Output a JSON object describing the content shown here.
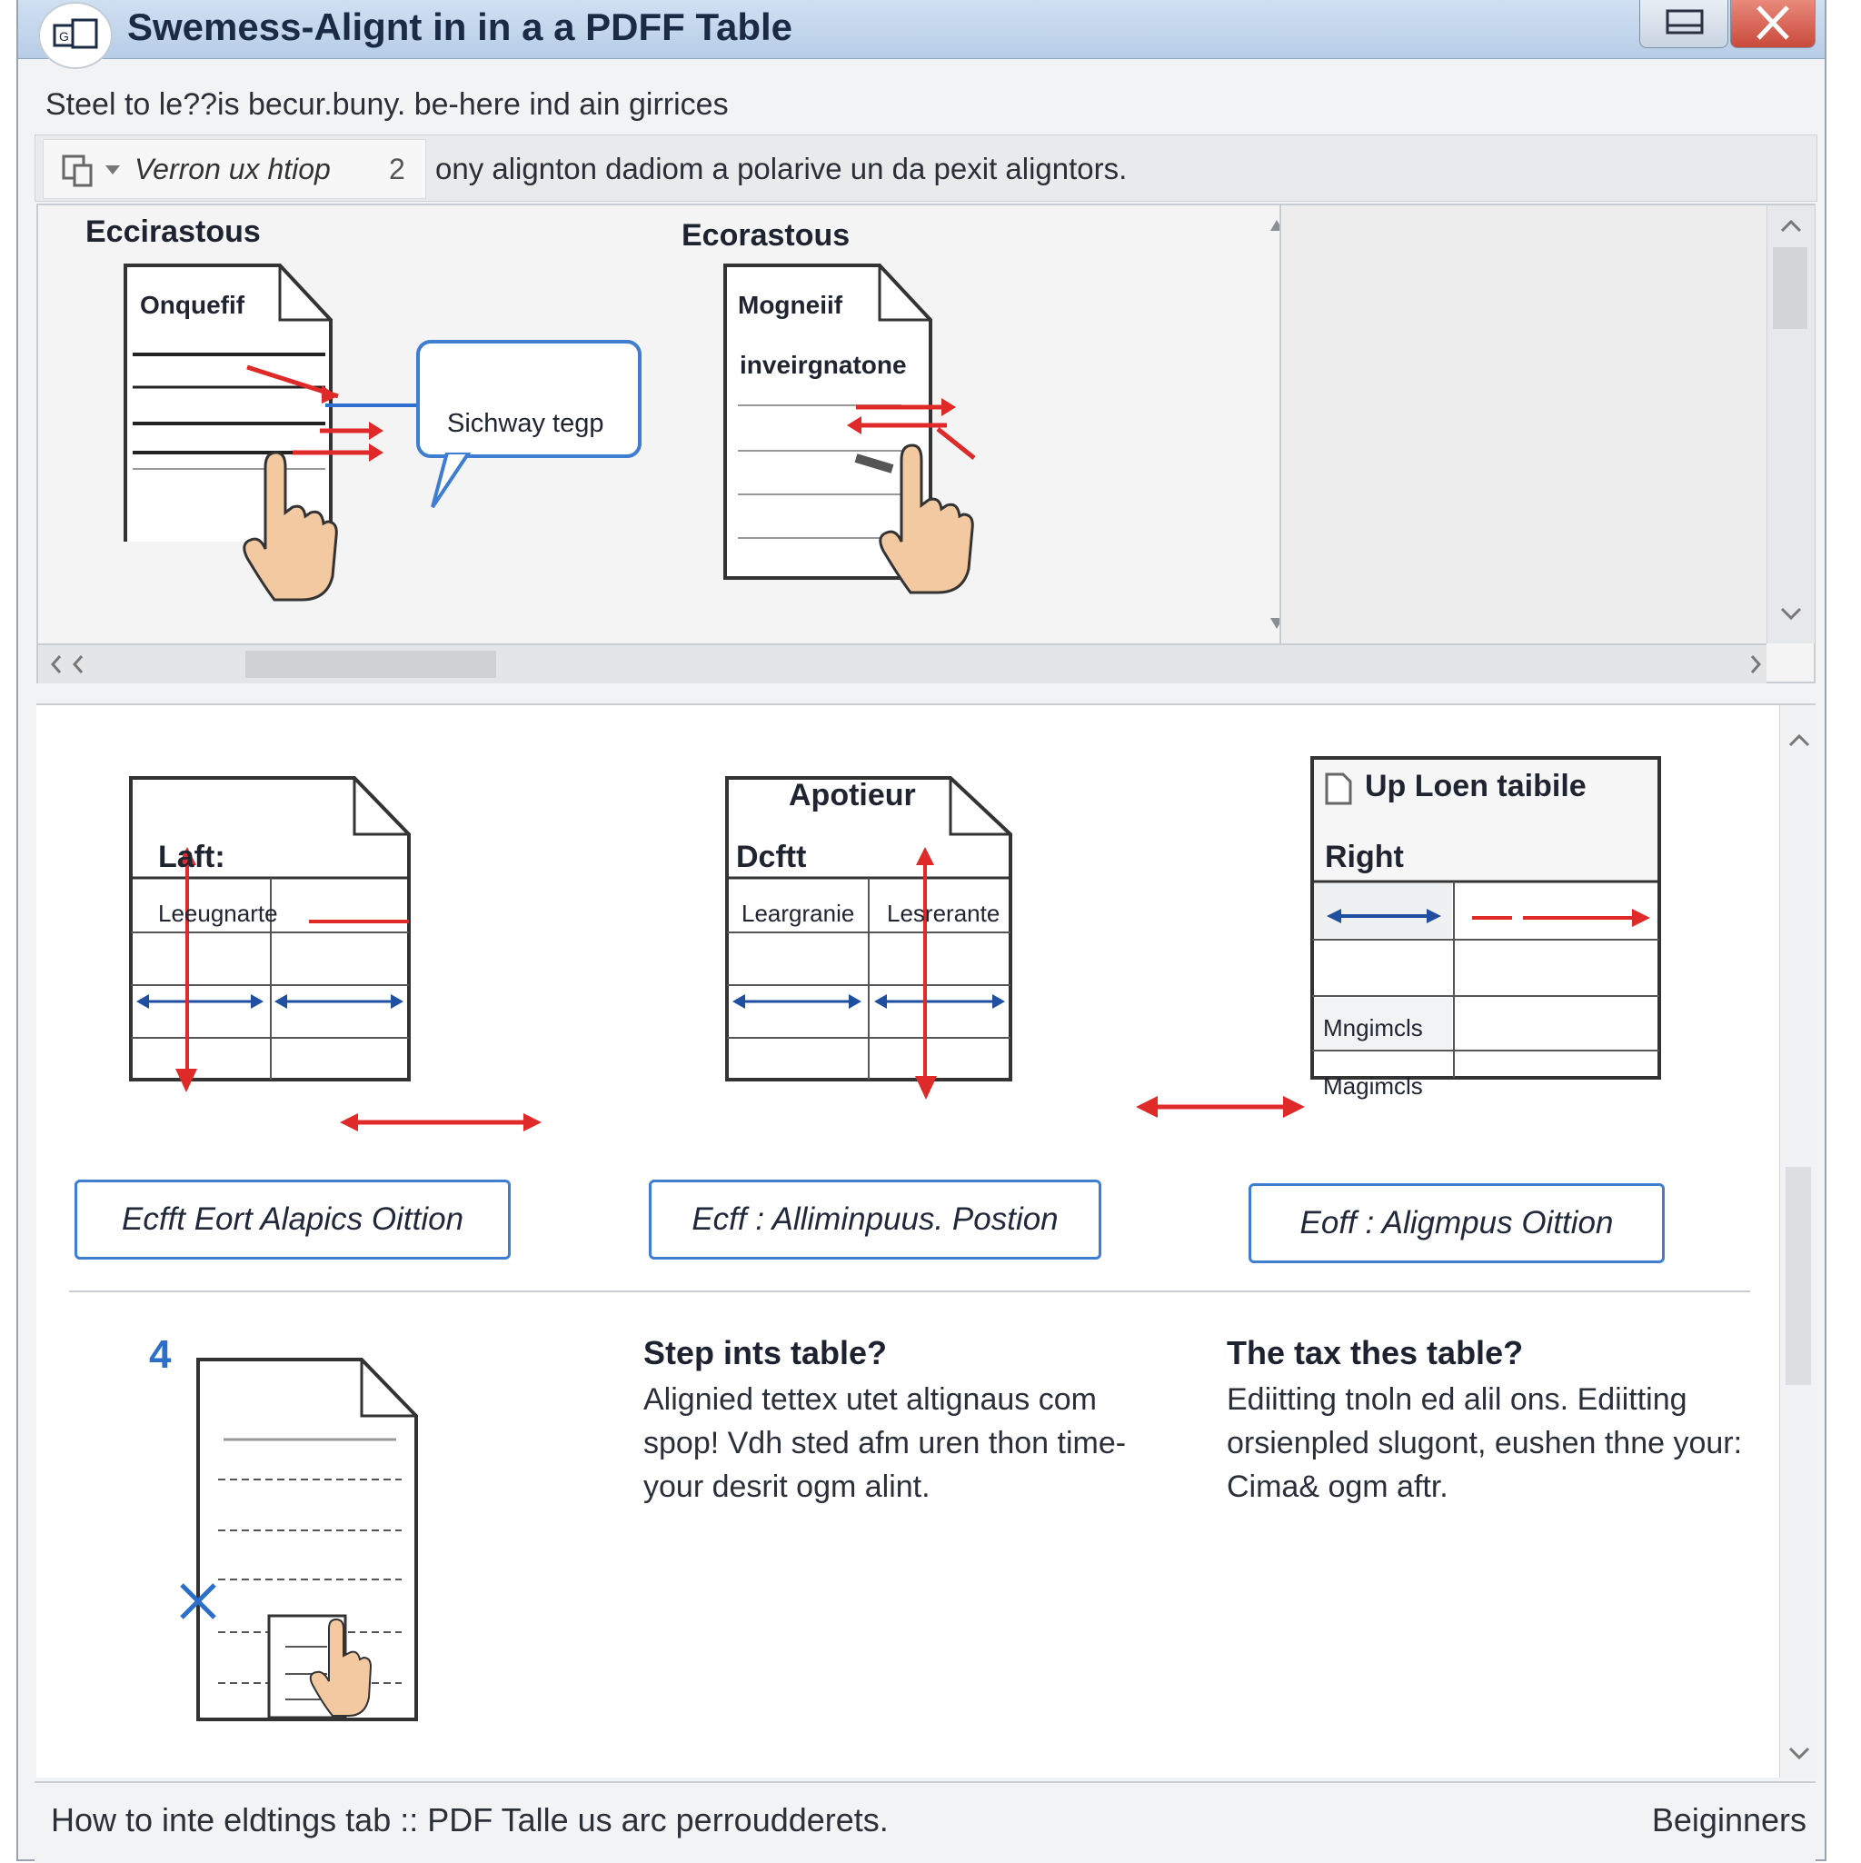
{
  "window": {
    "title": "Swemess-Alignt in in a a PDFF Table",
    "subtitle": "Steel to le??is becur.buny. be-here ind ain girrices"
  },
  "toolbar": {
    "view_label": "Verron ux htiop",
    "view_number": "2",
    "hint": "ony alignton dadiom a polarive un da pexit alignt​ors."
  },
  "top_pane": {
    "left": {
      "heading": "Eccirastous",
      "doc_title": "Onquefif",
      "callout": "Sichway tegp"
    },
    "right": {
      "heading": "Ecorastous",
      "doc_title": "Mogneiif",
      "doc_line": "inveirgnatone"
    }
  },
  "examples": [
    {
      "doc_title": "Laft:",
      "cell1": "Leeugnarte",
      "caption": "Ecfft Eort Alapics Oittion"
    },
    {
      "doc_title": "Apotieur",
      "doc_subtitle": "Dcftt",
      "cell1": "Leargranie",
      "cell2": "Lesrerante",
      "caption": "Ecff : Alliminpuus. Postion"
    },
    {
      "doc_title": "Up Loen taibile",
      "doc_subtitle": "Right",
      "row3": "Mngimcls",
      "row4": "Magimcls",
      "caption": "Eoff : Aligmpus Oittion"
    }
  ],
  "steps": {
    "number": "4",
    "col1_title": "Step ints table?",
    "col1_body": "Alignied tettex utet altignaus com spop! Vdh sted afm uren thon time- your desrit ogm alint.",
    "col2_title": "The tax thes table?",
    "col2_body": "Ediitting tnoln ed alil ons. Ediitting orsienpled slugont, eushen thne your: Cima& ogm aftr."
  },
  "status": {
    "left": "How to inte eldtings tab :: PDF Talle us arc perroudderets.",
    "right": "Beiginners"
  },
  "icons": [
    "app-icon",
    "restore-icon",
    "close-icon",
    "page-icon",
    "dropdown-icon",
    "hand-icon",
    "arrow-icon",
    "cross-icon"
  ],
  "colors": {
    "accent_blue": "#2f6fd0",
    "accent_red": "#e02a2a",
    "titlebar": "#c4d7ec"
  }
}
